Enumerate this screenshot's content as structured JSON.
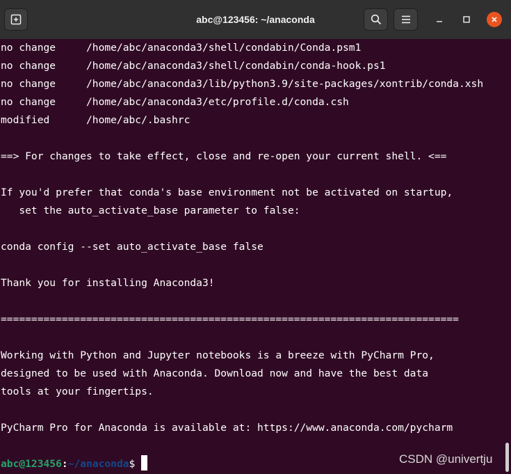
{
  "window": {
    "title": "abc@123456: ~/anaconda",
    "icons": {
      "new_tab": "new-tab-icon",
      "search": "search-icon",
      "menu": "hamburger-menu-icon",
      "minimize": "minimize-icon",
      "maximize": "maximize-icon",
      "close": "close-icon"
    },
    "colors": {
      "header": "#303030",
      "terminal_bg": "#300a24",
      "close_button": "#e95420",
      "prompt_user": "#26a269",
      "prompt_path": "#12488b"
    }
  },
  "terminal": {
    "lines": [
      "no change     /home/abc/anaconda3/shell/condabin/Conda.psm1",
      "no change     /home/abc/anaconda3/shell/condabin/conda-hook.ps1",
      "no change     /home/abc/anaconda3/lib/python3.9/site-packages/xontrib/conda.xsh",
      "no change     /home/abc/anaconda3/etc/profile.d/conda.csh",
      "modified      /home/abc/.bashrc",
      "",
      "==> For changes to take effect, close and re-open your current shell. <==",
      "",
      "If you'd prefer that conda's base environment not be activated on startup,",
      "   set the auto_activate_base parameter to false:",
      "",
      "conda config --set auto_activate_base false",
      "",
      "Thank you for installing Anaconda3!",
      "",
      "===========================================================================",
      "",
      "Working with Python and Jupyter notebooks is a breeze with PyCharm Pro,",
      "designed to be used with Anaconda. Download now and have the best data",
      "tools at your fingertips.",
      "",
      "PyCharm Pro for Anaconda is available at: https://www.anaconda.com/pycharm",
      ""
    ],
    "prompt": {
      "user_host": "abc@123456",
      "separator": ":",
      "path": "~/anaconda",
      "symbol": "$"
    }
  },
  "watermark": "CSDN @univertju"
}
